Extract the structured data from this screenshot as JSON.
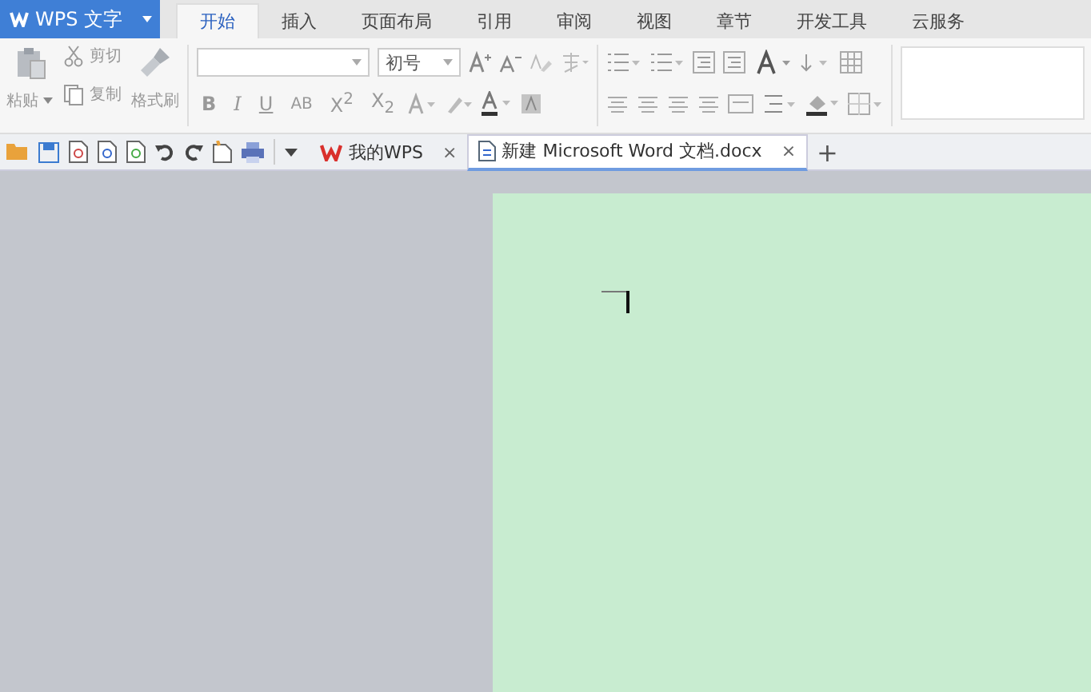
{
  "app_menu": {
    "label": "WPS 文字"
  },
  "ribbon_tabs": [
    {
      "label": "开始",
      "selected": true
    },
    {
      "label": "插入",
      "selected": false
    },
    {
      "label": "页面布局",
      "selected": false
    },
    {
      "label": "引用",
      "selected": false
    },
    {
      "label": "审阅",
      "selected": false
    },
    {
      "label": "视图",
      "selected": false
    },
    {
      "label": "章节",
      "selected": false
    },
    {
      "label": "开发工具",
      "selected": false
    },
    {
      "label": "云服务",
      "selected": false
    }
  ],
  "clipboard": {
    "paste": "粘贴",
    "cut": "剪切",
    "copy": "复制",
    "format_painter": "格式刷"
  },
  "font": {
    "size": "初号",
    "format_buttons": [
      {
        "kind": "bold",
        "label": "B"
      },
      {
        "kind": "italic",
        "label": "I"
      },
      {
        "kind": "underline",
        "label": "U"
      },
      {
        "kind": "strike",
        "label": "AB"
      },
      {
        "kind": "plain",
        "label": "X$^{2}$"
      },
      {
        "kind": "plain",
        "label": "X$_{2}$"
      }
    ]
  },
  "doc_tabs": [
    {
      "label": "我的WPS",
      "selected": false,
      "close": "×"
    },
    {
      "label": "新建 Microsoft Word 文档.docx",
      "selected": true,
      "close": "×"
    }
  ],
  "new_tab": "+"
}
